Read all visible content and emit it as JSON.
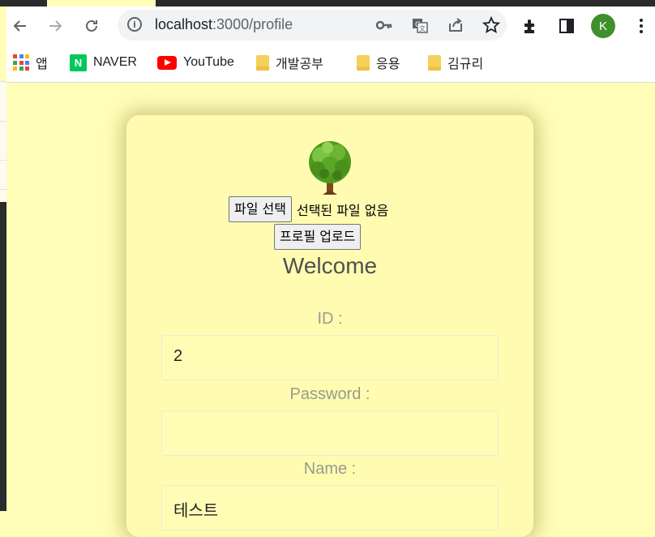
{
  "browser": {
    "url_host": "localhost",
    "url_path": ":3000/profile",
    "profile_initial": "K",
    "profile_color": "#3f8f2d"
  },
  "bookmarks": [
    {
      "label": "앱",
      "icon": "apps-grid-icon"
    },
    {
      "label": "NAVER",
      "icon": "naver-icon"
    },
    {
      "label": "YouTube",
      "icon": "youtube-icon"
    },
    {
      "label": "개발공부",
      "icon": "folder-icon"
    },
    {
      "label": "응용",
      "icon": "folder-icon"
    },
    {
      "label": "김규리",
      "icon": "folder-icon"
    }
  ],
  "profile": {
    "avatar_icon": "tree-icon",
    "choose_file_label": "파일 선택",
    "no_file_text": "선택된 파일 없음",
    "upload_label": "프로필 업로드",
    "welcome": "Welcome",
    "id_label": "ID :",
    "id_value": "2",
    "password_label": "Password :",
    "password_value": "",
    "name_label": "Name :",
    "name_value": "테스트"
  },
  "colors": {
    "page_bg": "#fffdb8",
    "card_bg": "#fffcb2",
    "label_text": "#9a9a8c"
  }
}
